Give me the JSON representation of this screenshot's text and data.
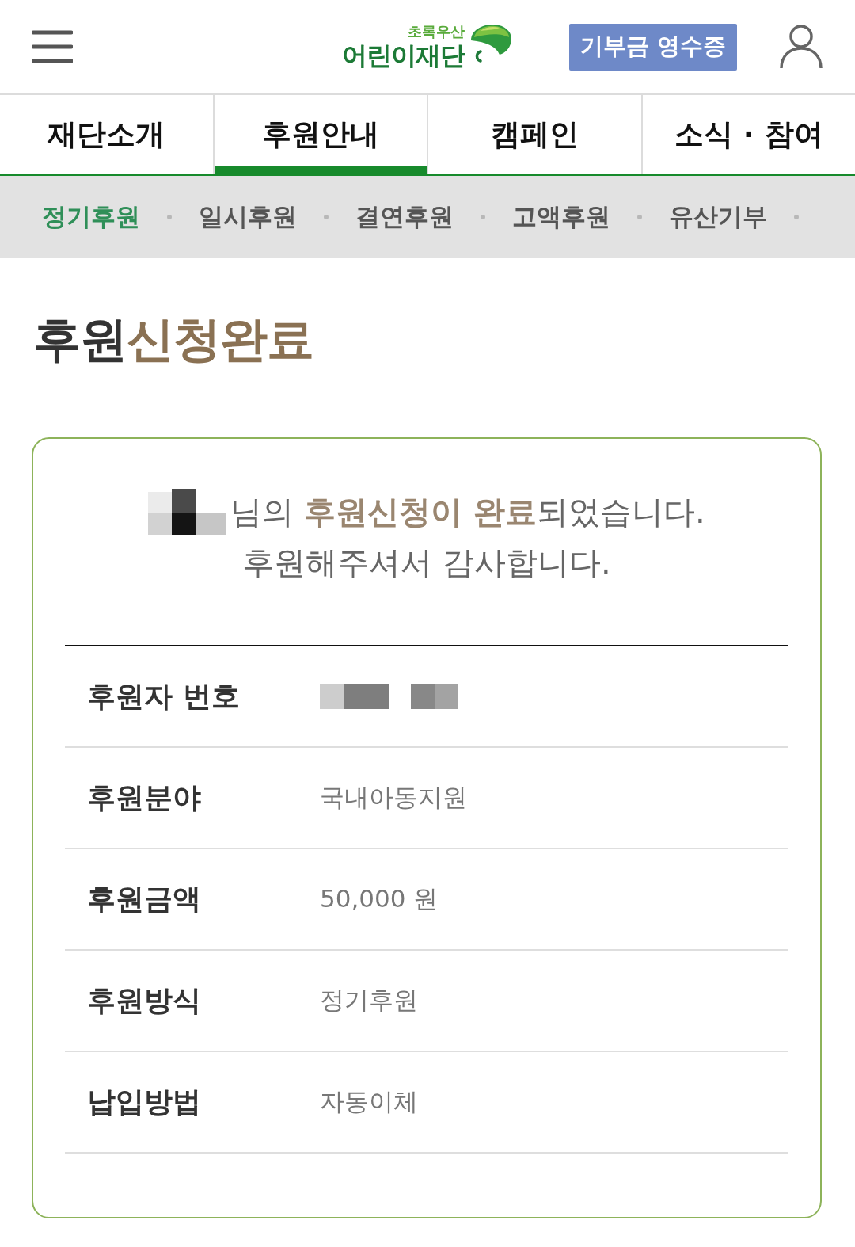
{
  "header": {
    "logo": {
      "tagline": "초록우산",
      "name": "어린이재단"
    },
    "receipt_button": "기부금 영수증"
  },
  "main_nav": [
    {
      "label": "재단소개",
      "selected": false
    },
    {
      "label": "후원안내",
      "selected": true
    },
    {
      "label": "캠페인",
      "selected": false
    },
    {
      "label": "소식 · 참여",
      "selected": false
    }
  ],
  "sub_nav": [
    {
      "label": "정기후원",
      "selected": true
    },
    {
      "label": "일시후원",
      "selected": false
    },
    {
      "label": "결연후원",
      "selected": false
    },
    {
      "label": "고액후원",
      "selected": false
    },
    {
      "label": "유산기부",
      "selected": false
    }
  ],
  "title": [
    {
      "text": "후원",
      "highlight": false
    },
    {
      "text": "신청완료",
      "highlight": true
    }
  ],
  "card": {
    "message": {
      "name_redacted": true,
      "line_1": [
        {
          "text": "님의 ",
          "highlight": false
        },
        {
          "text": "후원신청이 완료",
          "highlight": true
        },
        {
          "text": "되었습니다.",
          "highlight": false
        }
      ],
      "line_2": "후원해주셔서 감사합니다."
    },
    "rows": [
      {
        "label": "후원자 번호",
        "kind": "redacted"
      },
      {
        "label": "후원분야",
        "kind": "text",
        "value": "국내아동지원"
      },
      {
        "label": "후원금액",
        "kind": "text",
        "value": "50,000 원"
      },
      {
        "label": "후원방식",
        "kind": "text",
        "value": "정기후원"
      },
      {
        "label": "납입방법",
        "kind": "text",
        "value": "자동이체"
      }
    ]
  }
}
